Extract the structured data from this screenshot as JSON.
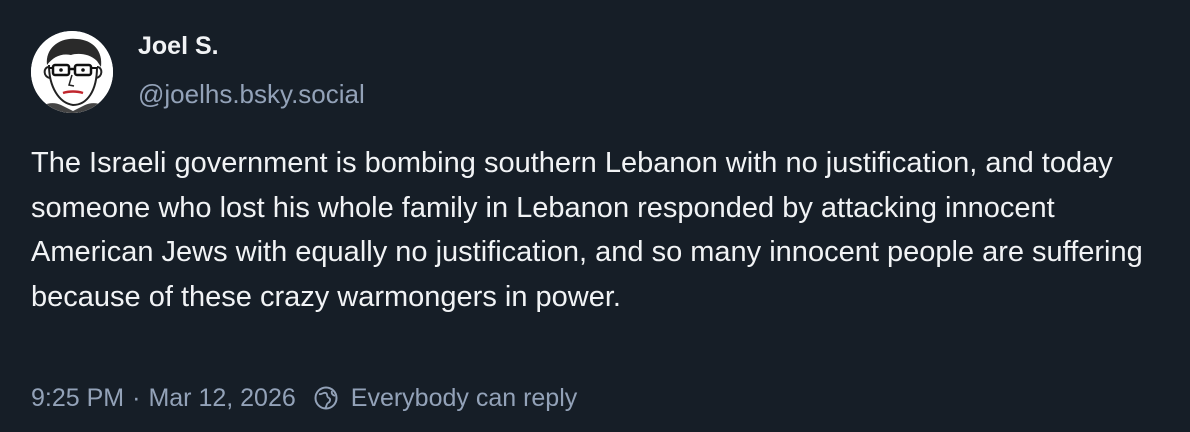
{
  "author": {
    "display_name": "Joel S.",
    "handle": "@joelhs.bsky.social",
    "avatar_icon": "cartoon-face-with-glasses-avatar"
  },
  "post": {
    "text": "The Israeli government is bombing southern Lebanon with no justification, and today someone who lost his whole family in Lebanon responded by attacking innocent American Jews with equally no justification, and so many innocent people are suffering because of these crazy warmongers in power."
  },
  "meta": {
    "time": "9:25 PM",
    "separator": "·",
    "date": "Mar 12, 2026",
    "reply_icon": "globe-icon",
    "reply_setting": "Everybody can reply"
  },
  "colors": {
    "background": "#161e27",
    "primary_text": "#f1f3f5",
    "secondary_text": "#93a2b8"
  }
}
